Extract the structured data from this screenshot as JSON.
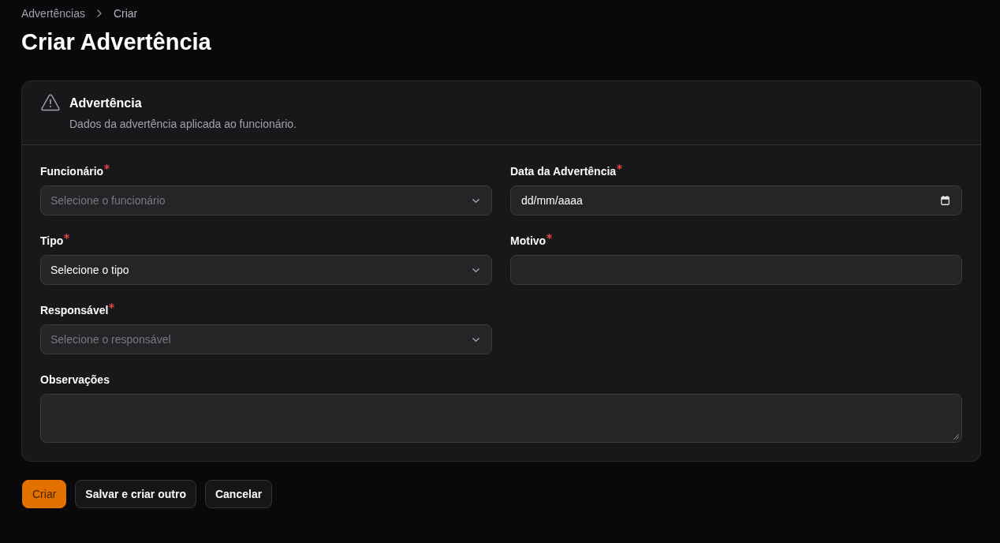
{
  "breadcrumbs": [
    {
      "label": "Advertências"
    },
    {
      "label": "Criar"
    }
  ],
  "page_title": "Criar Advertência",
  "section": {
    "title": "Advertência",
    "description": "Dados da advertência aplicada ao funcionário.",
    "fields": [
      {
        "kind": "select",
        "label": "Funcionário",
        "required": true,
        "placeholder": "Selecione o funcionário"
      },
      {
        "kind": "date",
        "label": "Data da Advertência",
        "required": true,
        "value": "dd/mm/aaaa"
      },
      {
        "kind": "select",
        "label": "Tipo",
        "required": true,
        "value": "Selecione o tipo"
      },
      {
        "kind": "text",
        "label": "Motivo",
        "required": true
      },
      {
        "kind": "select",
        "label": "Responsável",
        "required": true,
        "placeholder": "Selecione o responsável"
      },
      {
        "kind": "textarea",
        "label": "Observações",
        "required": false
      }
    ]
  },
  "actions": [
    {
      "kind": "primary",
      "label": "Criar"
    },
    {
      "kind": "secondary",
      "label": "Salvar e criar outro"
    },
    {
      "kind": "secondary",
      "label": "Cancelar"
    }
  ]
}
